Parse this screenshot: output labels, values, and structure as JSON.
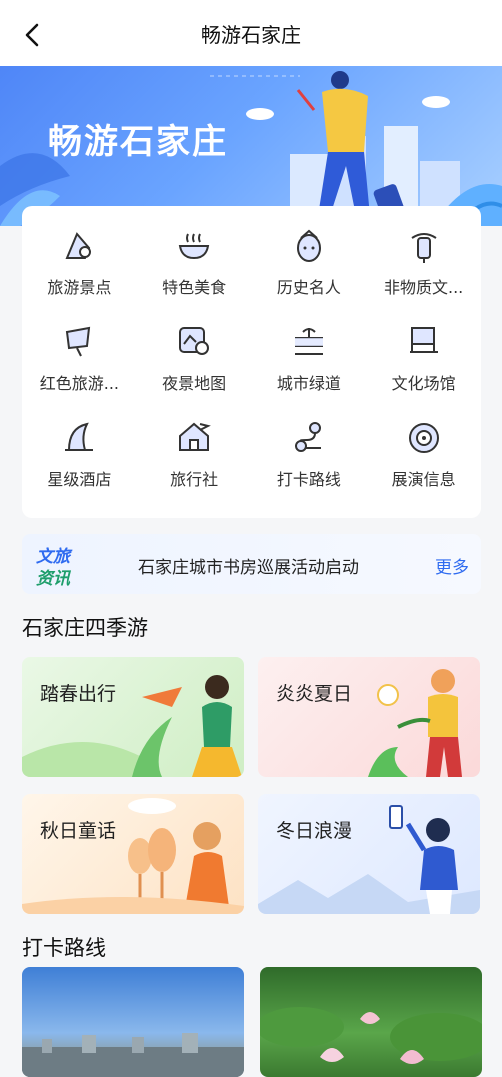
{
  "header": {
    "title": "畅游石家庄"
  },
  "banner": {
    "title": "畅游石家庄"
  },
  "categories": [
    {
      "label": "旅游景点",
      "icon": "scenic-spot-icon"
    },
    {
      "label": "特色美食",
      "icon": "food-bowl-icon"
    },
    {
      "label": "历史名人",
      "icon": "historical-figure-icon"
    },
    {
      "label": "非物质文...",
      "icon": "intangible-heritage-icon"
    },
    {
      "label": "红色旅游...",
      "icon": "red-tourism-flag-icon"
    },
    {
      "label": "夜景地图",
      "icon": "night-map-icon"
    },
    {
      "label": "城市绿道",
      "icon": "greenway-icon"
    },
    {
      "label": "文化场馆",
      "icon": "culture-venue-icon"
    },
    {
      "label": "星级酒店",
      "icon": "hotel-icon"
    },
    {
      "label": "旅行社",
      "icon": "travel-agency-icon"
    },
    {
      "label": "打卡路线",
      "icon": "checkin-route-icon"
    },
    {
      "label": "展演信息",
      "icon": "performance-disc-icon"
    }
  ],
  "news": {
    "logo_line1": "文旅",
    "logo_line2": "资讯",
    "text": "石家庄城市书房巡展活动启动",
    "more": "更多"
  },
  "seasons_section": {
    "title": "石家庄四季游"
  },
  "seasons": [
    {
      "label": "踏春出行"
    },
    {
      "label": "炎炎夏日"
    },
    {
      "label": "秋日童话"
    },
    {
      "label": "冬日浪漫"
    }
  ],
  "routes_section": {
    "title": "打卡路线"
  }
}
